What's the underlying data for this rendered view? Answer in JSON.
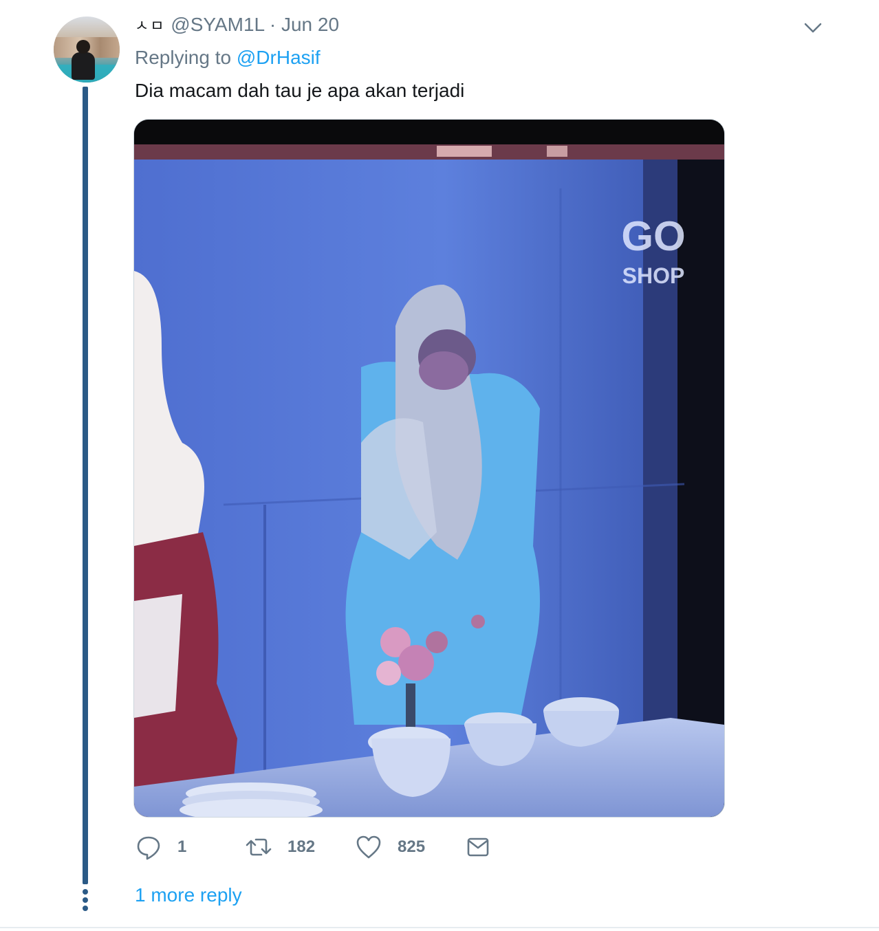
{
  "tweet": {
    "display_name": "ㅅㅁ",
    "handle": "@SYAM1L",
    "separator": "·",
    "date": "Jun 20",
    "replying_prefix": "Replying to ",
    "replying_to": "@DrHasif",
    "text": "Dia macam dah tau je apa akan terjadi",
    "media": {
      "watermark_line1": "GO",
      "watermark_line2": "SHOP"
    },
    "actions": {
      "replies": "1",
      "retweets": "182",
      "likes": "825"
    },
    "more_replies": "1 more reply"
  },
  "icons": {
    "menu": "chevron-down-icon",
    "reply": "reply-icon",
    "retweet": "retweet-icon",
    "like": "heart-icon",
    "dm": "envelope-icon"
  },
  "colors": {
    "link": "#1da1f2",
    "muted": "#657786",
    "thread": "#2b5a86"
  }
}
